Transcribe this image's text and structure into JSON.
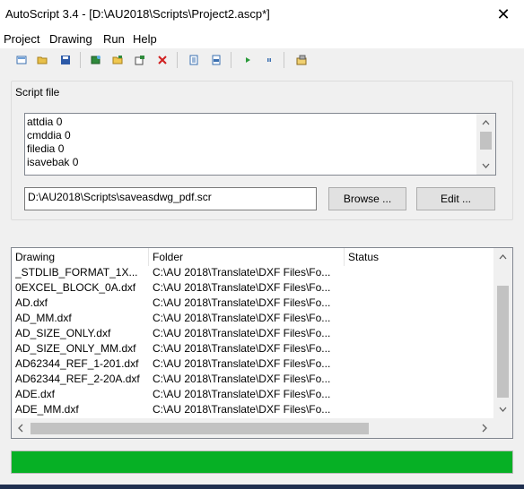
{
  "window": {
    "title": "AutoScript 3.4 - [D:\\AU2018\\Scripts\\Project2.ascp*]",
    "close_glyph": "✕"
  },
  "menu": [
    "Project",
    "Drawing",
    "Run",
    "Help"
  ],
  "toolbar": {
    "icons": [
      "new-project-icon",
      "open-project-icon",
      "save-project-icon",
      "add-drawings-icon",
      "add-folder-icon",
      "add-from-list-icon",
      "remove-drawing-icon",
      "select-all-icon",
      "invert-selection-icon",
      "run-icon",
      "pause-icon",
      "options-icon"
    ]
  },
  "script_group": {
    "label": "Script file",
    "lines": [
      "attdia 0",
      "cmddia 0",
      "filedia 0",
      "isavebak 0"
    ],
    "path": "D:\\AU2018\\Scripts\\saveasdwg_pdf.scr",
    "browse_label": "Browse ...",
    "edit_label": "Edit ..."
  },
  "drawings": {
    "columns": [
      "Drawing",
      "Folder",
      "Status"
    ],
    "rows": [
      {
        "drawing": "_STDLIB_FORMAT_1X...",
        "folder": "C:\\AU 2018\\Translate\\DXF Files\\Fo...",
        "status": ""
      },
      {
        "drawing": "0EXCEL_BLOCK_0A.dxf",
        "folder": "C:\\AU 2018\\Translate\\DXF Files\\Fo...",
        "status": ""
      },
      {
        "drawing": "AD.dxf",
        "folder": "C:\\AU 2018\\Translate\\DXF Files\\Fo...",
        "status": ""
      },
      {
        "drawing": "AD_MM.dxf",
        "folder": "C:\\AU 2018\\Translate\\DXF Files\\Fo...",
        "status": ""
      },
      {
        "drawing": "AD_SIZE_ONLY.dxf",
        "folder": "C:\\AU 2018\\Translate\\DXF Files\\Fo...",
        "status": ""
      },
      {
        "drawing": "AD_SIZE_ONLY_MM.dxf",
        "folder": "C:\\AU 2018\\Translate\\DXF Files\\Fo...",
        "status": ""
      },
      {
        "drawing": "AD62344_REF_1-201.dxf",
        "folder": "C:\\AU 2018\\Translate\\DXF Files\\Fo...",
        "status": ""
      },
      {
        "drawing": "AD62344_REF_2-20A.dxf",
        "folder": "C:\\AU 2018\\Translate\\DXF Files\\Fo...",
        "status": ""
      },
      {
        "drawing": "ADE.dxf",
        "folder": "C:\\AU 2018\\Translate\\DXF Files\\Fo...",
        "status": ""
      },
      {
        "drawing": "ADE_MM.dxf",
        "folder": "C:\\AU 2018\\Translate\\DXF Files\\Fo...",
        "status": ""
      }
    ]
  },
  "progress": {
    "fraction": 1.0,
    "color": "#06b025"
  }
}
